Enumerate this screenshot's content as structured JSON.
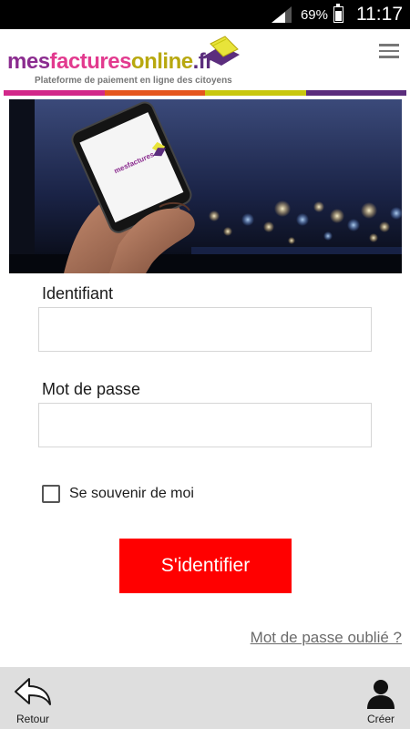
{
  "status_bar": {
    "battery_percent": "69%",
    "battery_level": 0.69,
    "time": "11:17"
  },
  "header": {
    "logo": {
      "part1": "mes",
      "part2": "factures",
      "part3": "online",
      "part4": ".fr",
      "tagline": "Plateforme de paiement en ligne des citoyens"
    },
    "menu_icon": "hamburger-menu-icon"
  },
  "stripe_colors": [
    "#d2288a",
    "#e5561e",
    "#c9c80f",
    "#5b2d7d"
  ],
  "form": {
    "username_label": "Identifiant",
    "username_value": "",
    "password_label": "Mot de passe",
    "password_value": "",
    "remember_label": "Se souvenir de moi",
    "remember_checked": false,
    "submit_label": "S'identifier",
    "forgot_label": "Mot de passe oublié ?"
  },
  "bottom_nav": {
    "back_label": "Retour",
    "back_icon": "back-arrow-icon",
    "create_label": "Créer",
    "create_icon": "user-icon"
  },
  "colors": {
    "accent": "#ff0000",
    "bottom_bar": "#dedede",
    "link": "#6b6b6b"
  }
}
